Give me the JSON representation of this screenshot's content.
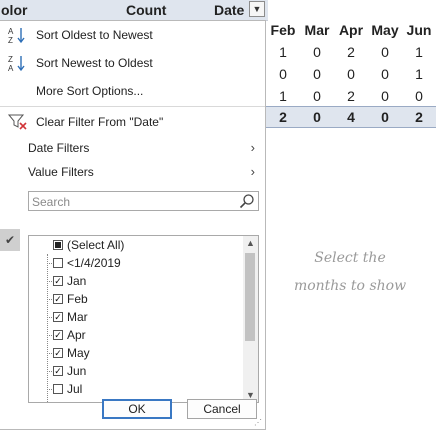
{
  "sheet": {
    "header": {
      "col_color_partial": "olor",
      "col_count": "Count",
      "col_date": "Date"
    },
    "months_header": [
      "Feb",
      "Mar",
      "Apr",
      "May",
      "Jun"
    ],
    "rows": [
      [
        "1",
        "0",
        "2",
        "0",
        "1"
      ],
      [
        "0",
        "0",
        "0",
        "0",
        "1"
      ],
      [
        "1",
        "0",
        "2",
        "0",
        "0"
      ]
    ],
    "totals": [
      "2",
      "0",
      "4",
      "0",
      "2"
    ],
    "note": "Select the months to show"
  },
  "menu": {
    "sort_asc": "Sort Oldest to Newest",
    "sort_desc": "Sort Newest to Oldest",
    "more_sort": "More Sort Options...",
    "clear_filter": "Clear Filter From \"Date\"",
    "date_filters": "Date Filters",
    "value_filters": "Value Filters",
    "search_placeholder": "Search",
    "select_all": "(Select All)",
    "items": [
      {
        "label": "<1/4/2019",
        "checked": false
      },
      {
        "label": "Jan",
        "checked": true
      },
      {
        "label": "Feb",
        "checked": true
      },
      {
        "label": "Mar",
        "checked": true
      },
      {
        "label": "Apr",
        "checked": true
      },
      {
        "label": "May",
        "checked": true
      },
      {
        "label": "Jun",
        "checked": true
      },
      {
        "label": "Jul",
        "checked": false
      }
    ],
    "ok": "OK",
    "cancel": "Cancel"
  }
}
